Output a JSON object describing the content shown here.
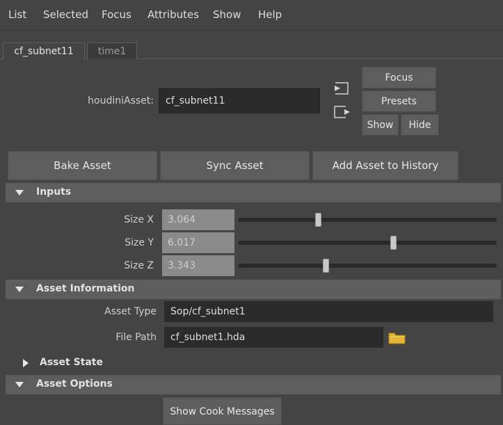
{
  "menu": [
    "List",
    "Selected",
    "Focus",
    "Attributes",
    "Show",
    "Help"
  ],
  "tabs": [
    "cf_subnet11",
    "time1"
  ],
  "asset": {
    "label": "houdiniAsset:",
    "value": "cf_subnet11",
    "buttons": {
      "focus": "Focus",
      "presets": "Presets",
      "show": "Show",
      "hide": "Hide"
    }
  },
  "actions": {
    "bake": "Bake Asset",
    "sync": "Sync Asset",
    "history": "Add Asset to History"
  },
  "inputs": {
    "title": "Inputs",
    "rows": [
      {
        "label": "Size X",
        "value": "3.064",
        "fraction": 0.31
      },
      {
        "label": "Size Y",
        "value": "6.017",
        "fraction": 0.6
      },
      {
        "label": "Size Z",
        "value": "3.343",
        "fraction": 0.34
      }
    ]
  },
  "asset_info": {
    "title": "Asset Information",
    "type_label": "Asset Type",
    "type_value": "Sop/cf_subnet1",
    "path_label": "File Path",
    "path_value": "cf_subnet1.hda",
    "folder_icon": "folder-icon"
  },
  "asset_state": {
    "title": "Asset State"
  },
  "asset_options": {
    "title": "Asset Options",
    "button": "Show Cook Messages"
  },
  "colors": {
    "background": "#444444",
    "section": "#5d5d5d",
    "field": "#2b2b2b",
    "folder": "#e3b735"
  }
}
